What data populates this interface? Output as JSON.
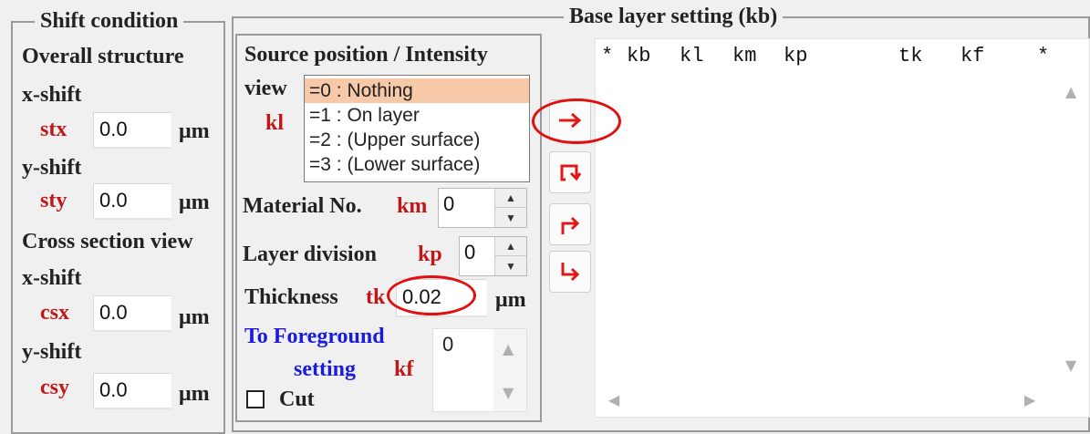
{
  "shift": {
    "legend": "Shift condition",
    "overall_label": "Overall structure",
    "xshift_label": "x-shift",
    "stx_label": "stx",
    "stx_value": "0.0",
    "yshift_label": "y-shift",
    "sty_label": "sty",
    "sty_value": "0.0",
    "cross_label": "Cross section view",
    "xshift2_label": "x-shift",
    "csx_label": "csx",
    "csx_value": "0.0",
    "yshift2_label": "y-shift",
    "csy_label": "csy",
    "csy_value": "0.0",
    "unit": "μm"
  },
  "source": {
    "title": "Source position / Intensity",
    "view_label": "view",
    "kl_label": "kl",
    "options": [
      "=0 : Nothing",
      "=1 : On layer",
      "=2 : (Upper surface)",
      "=3 : (Lower surface)"
    ],
    "selected_index": 0,
    "material_label": "Material No.",
    "km_label": "km",
    "km_value": "0",
    "layer_div_label": "Layer division",
    "kp_label": "kp",
    "kp_value": "0",
    "thickness_label": "Thickness",
    "tk_label": "tk",
    "tk_value": "0.02",
    "unit": "μm",
    "foreground_line1": "To Foreground",
    "foreground_line2": "setting",
    "kf_label": "kf",
    "kf_value": "0",
    "cut_label": "Cut",
    "cut_checked": false
  },
  "base": {
    "legend": "Base layer setting (kb)",
    "columns": [
      "*",
      "kb",
      "kl",
      "km",
      "kp",
      "tk",
      "kf",
      "*"
    ],
    "rows": []
  },
  "buttons": {
    "add_icon": "right-arrow-icon",
    "return_icon": "hook-return-icon",
    "turn_up_icon": "turn-right-up-icon",
    "turn_down_icon": "turn-down-right-icon"
  },
  "colors": {
    "label_red": "#c01818",
    "link_blue": "#1a1ae0",
    "list_selection": "#f7c9a8",
    "annotation_red": "#e01010"
  }
}
